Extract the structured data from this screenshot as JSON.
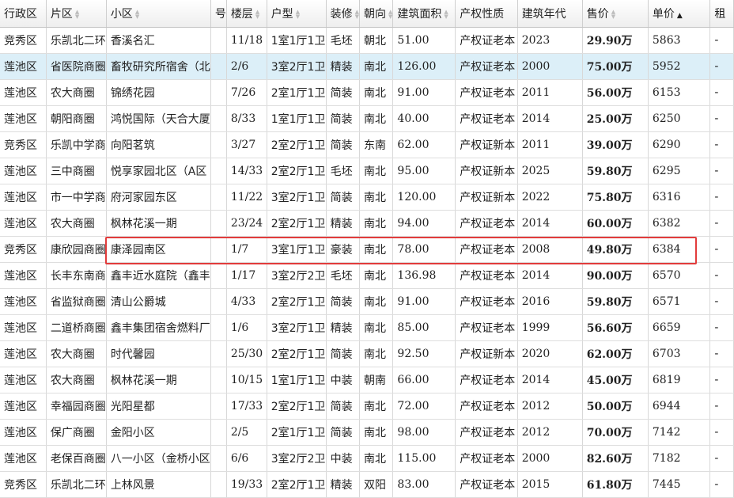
{
  "columns": [
    {
      "label": "行政区",
      "sort": "none"
    },
    {
      "label": "片区",
      "sort": "arrows"
    },
    {
      "label": "小区",
      "sort": "arrows"
    },
    {
      "label": "号",
      "sort": "none"
    },
    {
      "label": "楼层",
      "sort": "arrows"
    },
    {
      "label": "户型",
      "sort": "arrows"
    },
    {
      "label": "装修",
      "sort": "arrows"
    },
    {
      "label": "朝向",
      "sort": "arrows"
    },
    {
      "label": "建筑面积",
      "sort": "arrows"
    },
    {
      "label": "产权性质",
      "sort": "none"
    },
    {
      "label": "建筑年代",
      "sort": "none"
    },
    {
      "label": "售价",
      "sort": "arrows"
    },
    {
      "label": "单价",
      "sort": "asc"
    },
    {
      "label": "租",
      "sort": "none"
    }
  ],
  "rows": [
    [
      "竞秀区",
      "乐凯北二环",
      "香溪名汇",
      "",
      "11/18",
      "1室1厅1卫",
      "毛坯",
      "朝北",
      "51.00",
      "产权证老本",
      "2023",
      "29.90万",
      "5863",
      "-"
    ],
    [
      "莲池区",
      "省医院商圈",
      "畜牧研究所宿舍（北",
      "",
      "2/6",
      "3室2厅1卫",
      "精装",
      "南北",
      "126.00",
      "产权证老本",
      "2000",
      "75.00万",
      "5952",
      "-"
    ],
    [
      "莲池区",
      "农大商圈",
      "锦绣花园",
      "",
      "7/26",
      "2室1厅1卫",
      "简装",
      "南北",
      "91.00",
      "产权证老本",
      "2011",
      "56.00万",
      "6153",
      "-"
    ],
    [
      "莲池区",
      "朝阳商圈",
      "鸿悦国际（天合大厦",
      "",
      "8/33",
      "1室1厅1卫",
      "简装",
      "南北",
      "40.00",
      "产权证老本",
      "2014",
      "25.00万",
      "6250",
      "-"
    ],
    [
      "竞秀区",
      "乐凯中学商",
      "向阳茗筑",
      "",
      "3/27",
      "2室2厅1卫",
      "简装",
      "东南",
      "62.00",
      "产权证新本",
      "2011",
      "39.00万",
      "6290",
      "-"
    ],
    [
      "莲池区",
      "三中商圈",
      "悦享家园北区（A区",
      "",
      "14/33",
      "2室2厅1卫",
      "毛坯",
      "南北",
      "95.00",
      "产权证新本",
      "2025",
      "59.80万",
      "6295",
      "-"
    ],
    [
      "莲池区",
      "市一中学商",
      "府河家园东区",
      "",
      "11/22",
      "3室2厅1卫",
      "简装",
      "南北",
      "120.00",
      "产权证新本",
      "2022",
      "75.80万",
      "6316",
      "-"
    ],
    [
      "莲池区",
      "农大商圈",
      "枫林花溪一期",
      "",
      "23/24",
      "2室2厅1卫",
      "精装",
      "南北",
      "94.00",
      "产权证老本",
      "2014",
      "60.00万",
      "6382",
      "-"
    ],
    [
      "竞秀区",
      "康欣园商圈",
      "康泽园南区",
      "",
      "1/7",
      "3室1厅1卫",
      "豪装",
      "南北",
      "78.00",
      "产权证老本",
      "2008",
      "49.80万",
      "6384",
      "-"
    ],
    [
      "莲池区",
      "长丰东南商",
      "鑫丰近水庭院（鑫丰",
      "",
      "1/17",
      "3室2厅2卫",
      "毛坯",
      "南北",
      "136.98",
      "产权证老本",
      "2014",
      "90.00万",
      "6570",
      "-"
    ],
    [
      "莲池区",
      "省监狱商圈",
      "清山公爵城",
      "",
      "4/33",
      "2室2厅1卫",
      "简装",
      "南北",
      "91.00",
      "产权证老本",
      "2016",
      "59.80万",
      "6571",
      "-"
    ],
    [
      "莲池区",
      "二道桥商圈",
      "鑫丰集团宿舍燃料厂",
      "",
      "1/6",
      "3室2厅1卫",
      "精装",
      "南北",
      "85.00",
      "产权证老本",
      "1999",
      "56.60万",
      "6659",
      "-"
    ],
    [
      "莲池区",
      "农大商圈",
      "时代馨园",
      "",
      "25/30",
      "2室2厅1卫",
      "简装",
      "南北",
      "92.50",
      "产权证新本",
      "2020",
      "62.00万",
      "6703",
      "-"
    ],
    [
      "莲池区",
      "农大商圈",
      "枫林花溪一期",
      "",
      "10/15",
      "1室1厅1卫",
      "中装",
      "朝南",
      "66.00",
      "产权证老本",
      "2014",
      "45.00万",
      "6819",
      "-"
    ],
    [
      "莲池区",
      "幸福园商圈",
      "光阳星都",
      "",
      "17/33",
      "2室2厅1卫",
      "简装",
      "南北",
      "72.00",
      "产权证老本",
      "2012",
      "50.00万",
      "6944",
      "-"
    ],
    [
      "莲池区",
      "保广商圈",
      "金阳小区",
      "",
      "2/5",
      "2室1厅1卫",
      "简装",
      "南北",
      "98.00",
      "产权证老本",
      "2012",
      "70.00万",
      "7142",
      "-"
    ],
    [
      "莲池区",
      "老保百商圈",
      "八一小区（金桥小区",
      "",
      "6/6",
      "3室2厅2卫",
      "中装",
      "南北",
      "115.00",
      "产权证老本",
      "2000",
      "82.60万",
      "7182",
      "-"
    ],
    [
      "竞秀区",
      "乐凯北二环",
      "上林风景",
      "",
      "19/33",
      "2室2厅1卫",
      "精装",
      "双阳",
      "83.00",
      "产权证老本",
      "2015",
      "61.80万",
      "7445",
      "-"
    ]
  ],
  "selected_row": 1,
  "highlighted_row": 8,
  "colors": {
    "price": "#e0001b",
    "selection": "#dceff8",
    "highlight_border": "#e23c3c"
  }
}
